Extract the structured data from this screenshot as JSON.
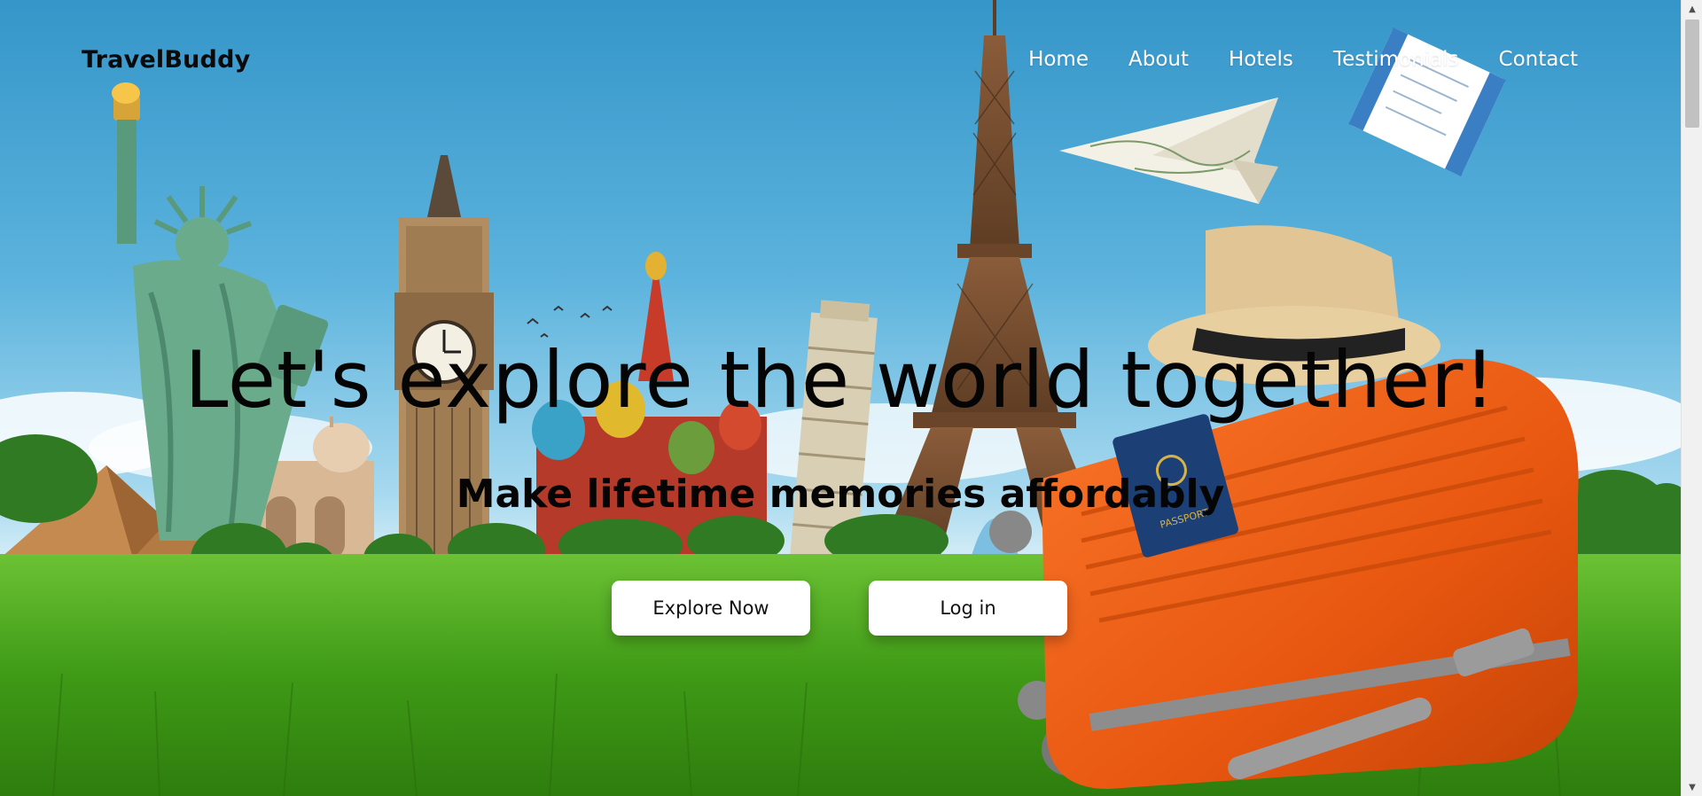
{
  "brand": {
    "name": "TravelBuddy"
  },
  "nav": {
    "items": [
      {
        "label": "Home"
      },
      {
        "label": "About"
      },
      {
        "label": "Hotels"
      },
      {
        "label": "Testimonials"
      },
      {
        "label": "Contact"
      }
    ]
  },
  "hero": {
    "title": "Let's explore the world together!",
    "subtitle": "Make lifetime memories affordably",
    "buttons": {
      "explore_label": "Explore Now",
      "login_label": "Log in"
    },
    "image_icons": [
      "statue-of-liberty",
      "big-ben",
      "saint-basils-cathedral",
      "leaning-tower-of-pisa",
      "eiffel-tower",
      "pyramids",
      "taj-mahal",
      "paper-plane-map",
      "plane-ticket",
      "straw-hat",
      "orange-suitcase",
      "passport"
    ],
    "passport_text": "PASSPORT"
  },
  "colors": {
    "sky_top": "#3f9fd0",
    "sky_bottom": "#bfe3f3",
    "grass": "#4fa51c",
    "suitcase": "#ec5a16",
    "nav_text": "#ffffff",
    "heading_text": "#050505",
    "button_bg": "#ffffff"
  }
}
